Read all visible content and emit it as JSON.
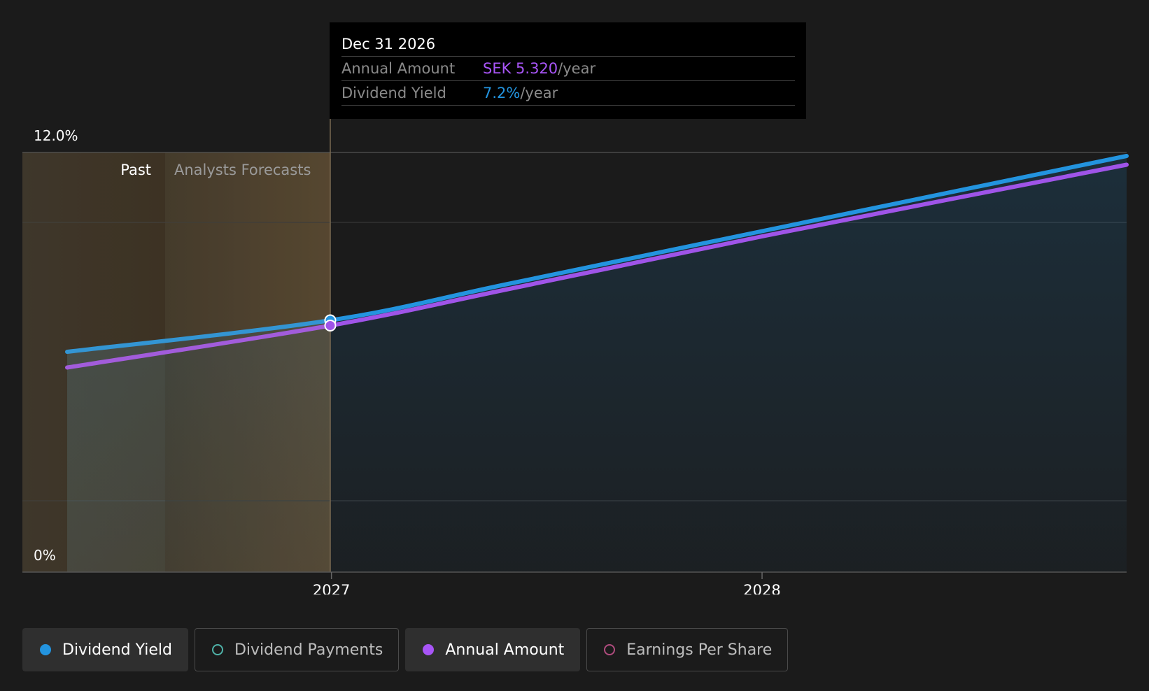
{
  "tooltip": {
    "date": "Dec 31 2026",
    "rows": [
      {
        "label": "Annual Amount",
        "value": "SEK 5.320",
        "unit": "/year",
        "color": "#a855f7"
      },
      {
        "label": "Dividend Yield",
        "value": "7.2%",
        "unit": "/year",
        "color": "#2394df"
      }
    ]
  },
  "chart_data": {
    "type": "line",
    "ylim": [
      0,
      12
    ],
    "y_tick_labels": [
      "12.0%",
      "0%"
    ],
    "x_tick_labels": [
      "2027",
      "2028"
    ],
    "x_ticks": [
      "2027-01-01",
      "2028-01-01"
    ],
    "xlim": [
      "2026-05-22",
      "2028-11-05"
    ],
    "past_until": "2026-08-13",
    "forecast_until": "2026-12-31",
    "past_label": "Past",
    "forecast_label": "Analysts Forecasts",
    "highlight_date": "2026-12-31",
    "grid": true,
    "series": [
      {
        "name": "Dividend Yield",
        "color": "#2394df",
        "points": [
          [
            "2026-05-22",
            6.3
          ],
          [
            "2026-12-31",
            7.2
          ],
          [
            "2027-06-01",
            8.25
          ],
          [
            "2028-01-01",
            9.75
          ],
          [
            "2028-11-05",
            11.9
          ]
        ]
      },
      {
        "name": "Annual Amount",
        "color": "#9f54e8",
        "points": [
          [
            "2026-05-22",
            5.85
          ],
          [
            "2026-12-31",
            7.05
          ],
          [
            "2027-06-01",
            8.1
          ],
          [
            "2028-01-01",
            9.6
          ],
          [
            "2028-11-05",
            11.65
          ]
        ]
      }
    ]
  },
  "legend": [
    {
      "label": "Dividend Yield",
      "color": "#2394df",
      "active": true
    },
    {
      "label": "Dividend Payments",
      "color": "#4fb3a9",
      "active": false
    },
    {
      "label": "Annual Amount",
      "color": "#a855f7",
      "active": true
    },
    {
      "label": "Earnings Per Share",
      "color": "#b04c7e",
      "active": false
    }
  ]
}
